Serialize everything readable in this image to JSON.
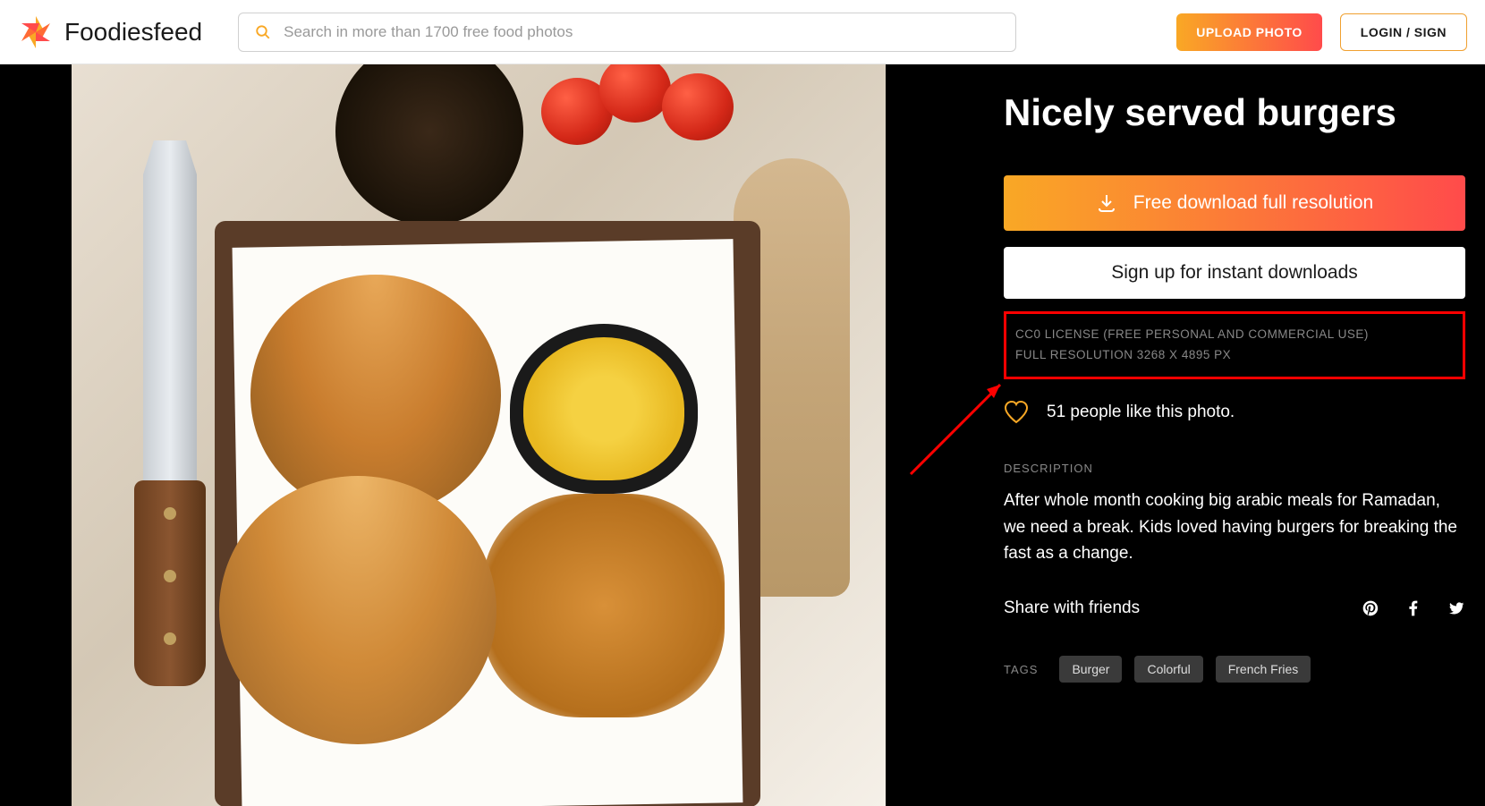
{
  "header": {
    "logo_text": "Foodiesfeed",
    "search_placeholder": "Search in more than 1700 free food photos",
    "upload_label": "UPLOAD PHOTO",
    "login_label": "LOGIN / SIGN"
  },
  "detail": {
    "title": "Nicely served burgers",
    "download_label": "Free download full resolution",
    "signup_label": "Sign up for instant downloads",
    "license_line": "CC0 LICENSE (FREE PERSONAL AND COMMERCIAL USE)",
    "resolution_line": "FULL RESOLUTION 3268 X 4895 PX",
    "likes_text": "51 people like this photo.",
    "description_label": "DESCRIPTION",
    "description_text": "After whole month cooking big arabic meals for Ramadan, we need a break. Kids loved having burgers for breaking the fast as a change.",
    "share_label": "Share with friends",
    "tags_label": "TAGS",
    "tags": [
      "Burger",
      "Colorful",
      "French Fries"
    ]
  },
  "colors": {
    "accent_gradient_start": "#f9a825",
    "accent_gradient_end": "#ff4b4b"
  }
}
